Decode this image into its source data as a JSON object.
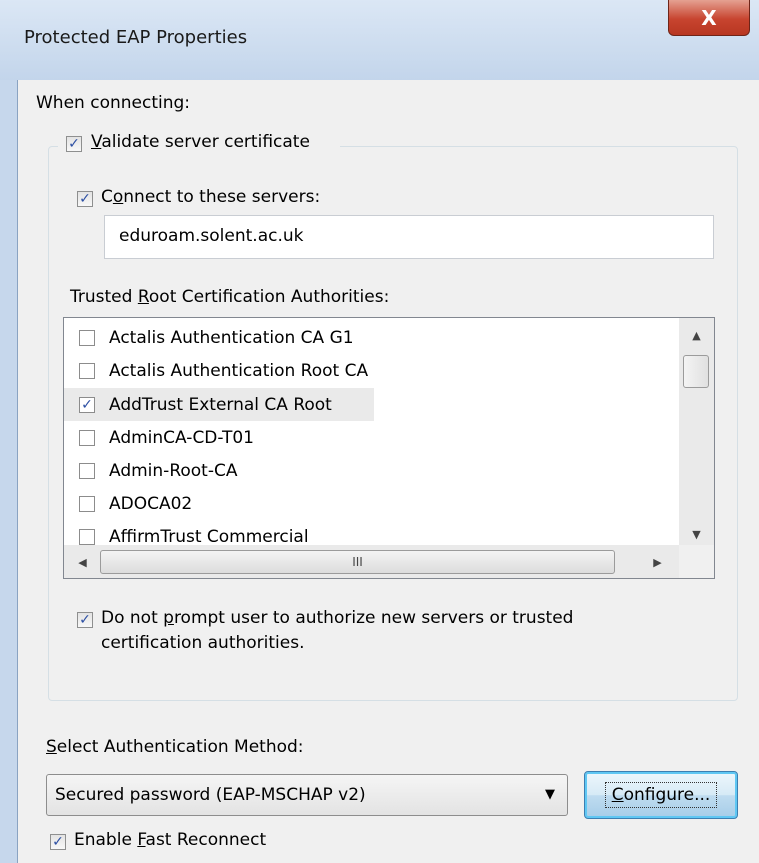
{
  "window": {
    "title": "Protected EAP Properties",
    "close_label": "X"
  },
  "when_connecting_label": "When connecting:",
  "validate_cert": {
    "label": "Validate server certificate",
    "accel": "V",
    "rest": "alidate server certificate",
    "checked": true
  },
  "connect_servers": {
    "label": "Connect to these servers:",
    "pre": "C",
    "accel": "o",
    "rest": "nnect to these servers:",
    "checked": true,
    "value": "eduroam.solent.ac.uk"
  },
  "trusted_root": {
    "pre": "Trusted ",
    "accel": "R",
    "rest": "oot Certification Authorities:"
  },
  "ca_list": [
    {
      "name": "Actalis Authentication CA G1",
      "checked": false
    },
    {
      "name": "Actalis Authentication Root CA",
      "checked": false
    },
    {
      "name": "AddTrust External CA Root",
      "checked": true
    },
    {
      "name": "AdminCA-CD-T01",
      "checked": false
    },
    {
      "name": "Admin-Root-CA",
      "checked": false
    },
    {
      "name": "ADOCA02",
      "checked": false
    },
    {
      "name": "AffirmTrust Commercial",
      "checked": false
    }
  ],
  "scrollbar": {
    "h_thumb_grip": "III"
  },
  "do_not_prompt": {
    "line1_pre": "Do not ",
    "accel": "p",
    "line1_rest": "rompt user to authorize new servers or trusted",
    "line2": "certification authorities.",
    "checked": true
  },
  "auth_method": {
    "accel": "S",
    "rest": "elect Authentication Method:"
  },
  "auth_combo": {
    "value": "Secured password (EAP-MSCHAP v2)"
  },
  "configure_button": {
    "accel": "C",
    "rest": "onfigure..."
  },
  "fast_reconnect": {
    "pre": "Enable ",
    "accel": "F",
    "rest": "ast Reconnect",
    "checked": true
  }
}
